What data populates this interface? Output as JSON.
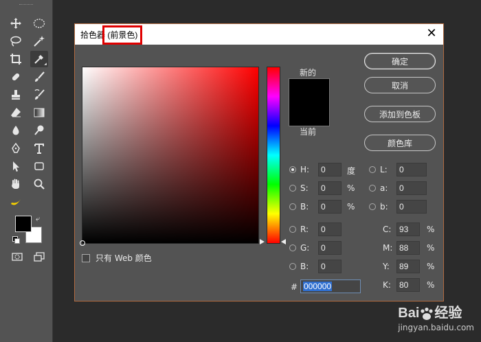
{
  "dialog": {
    "title_prefix": "拾色器",
    "title_highlight": "(前景色)",
    "close": "✕"
  },
  "buttons": {
    "ok": "确定",
    "cancel": "取消",
    "add_swatch": "添加到色板",
    "libraries": "颜色库"
  },
  "preview": {
    "new_label": "新的",
    "current_label": "当前"
  },
  "web_only_label": "只有 Web 颜色",
  "hsb": {
    "h": {
      "label": "H:",
      "value": "0",
      "unit": "度"
    },
    "s": {
      "label": "S:",
      "value": "0",
      "unit": "%"
    },
    "b": {
      "label": "B:",
      "value": "0",
      "unit": "%"
    }
  },
  "rgb": {
    "r": {
      "label": "R:",
      "value": "0"
    },
    "g": {
      "label": "G:",
      "value": "0"
    },
    "b": {
      "label": "B:",
      "value": "0"
    }
  },
  "lab": {
    "l": {
      "label": "L:",
      "value": "0"
    },
    "a": {
      "label": "a:",
      "value": "0"
    },
    "b": {
      "label": "b:",
      "value": "0"
    }
  },
  "cmyk": {
    "c": {
      "label": "C:",
      "value": "93",
      "unit": "%"
    },
    "m": {
      "label": "M:",
      "value": "88",
      "unit": "%"
    },
    "y": {
      "label": "Y:",
      "value": "89",
      "unit": "%"
    },
    "k": {
      "label": "K:",
      "value": "80",
      "unit": "%"
    }
  },
  "hex": {
    "label": "#",
    "value": "000000"
  },
  "watermark": {
    "brand": "Bai",
    "brand2": "经验",
    "url": "jingyan.baidu.com"
  },
  "colors": {
    "accent": "#b06a40",
    "highlight_box": "#e00000",
    "selection": "#2f6fd0"
  }
}
